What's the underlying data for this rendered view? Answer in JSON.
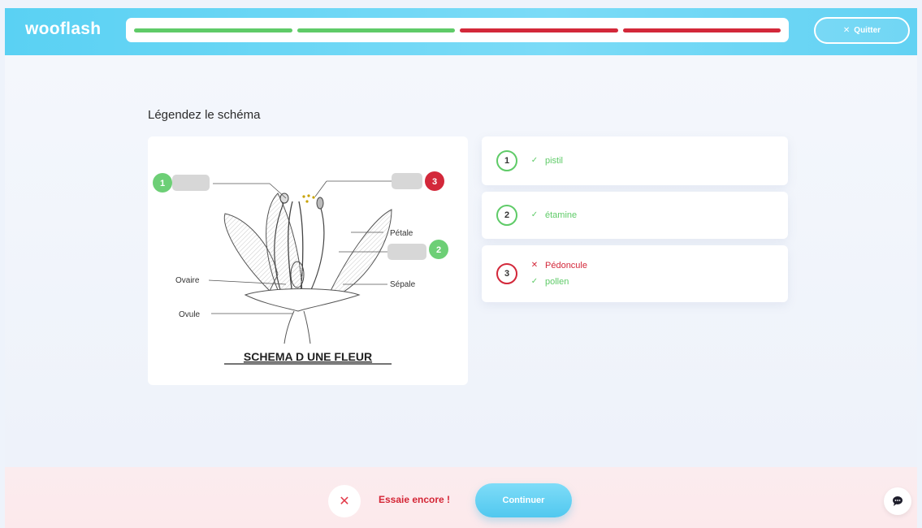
{
  "header": {
    "logo": "wooflash",
    "progress": [
      {
        "status": "correct",
        "color": "#5fcb68"
      },
      {
        "status": "correct",
        "color": "#5fcb68"
      },
      {
        "status": "wrong",
        "color": "#d3283a"
      },
      {
        "status": "wrong",
        "color": "#d3283a"
      }
    ],
    "quit": {
      "icon": "close-icon",
      "label": "Quitter"
    }
  },
  "question": {
    "title": "Légendez le schéma",
    "diagram": {
      "labels": {
        "petale": "Pétale",
        "sepale": "Sépale",
        "ovaire": "Ovaire",
        "ovule": "Ovule"
      },
      "caption": "SCHEMA D UNE FLEUR",
      "markers": [
        {
          "number": "1",
          "status": "correct"
        },
        {
          "number": "2",
          "status": "correct"
        },
        {
          "number": "3",
          "status": "wrong"
        }
      ]
    }
  },
  "answers": [
    {
      "number": "1",
      "status": "correct",
      "lines": [
        {
          "mark": "✓",
          "text": "pistil",
          "status": "correct"
        }
      ]
    },
    {
      "number": "2",
      "status": "correct",
      "lines": [
        {
          "mark": "✓",
          "text": "étamine",
          "status": "correct"
        }
      ]
    },
    {
      "number": "3",
      "status": "wrong",
      "lines": [
        {
          "mark": "✕",
          "text": "Pédoncule",
          "status": "wrong"
        },
        {
          "mark": "✓",
          "text": "pollen",
          "status": "correct"
        }
      ]
    }
  ],
  "footer": {
    "result_icon": "close-icon",
    "message": "Essaie encore !",
    "continue_label": "Continuer",
    "chat_icon": "chat-icon"
  },
  "colors": {
    "correct": "#5fcb68",
    "wrong": "#d3283a",
    "accent": "#5ad1f3"
  }
}
